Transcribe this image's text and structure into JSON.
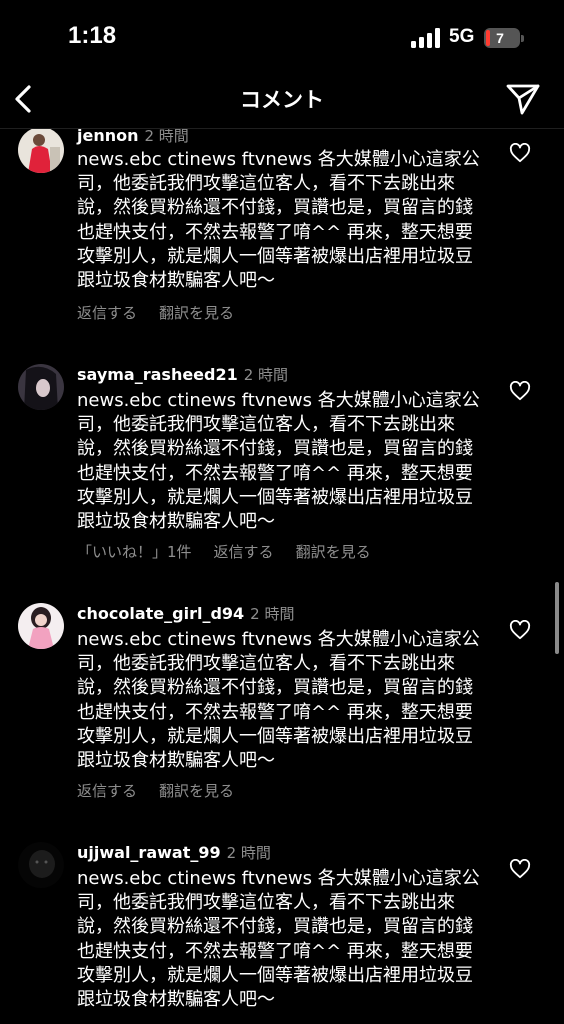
{
  "status_bar": {
    "time": "1:18",
    "network": "5G",
    "battery_level": "7",
    "battery_fill_fraction": 0.07
  },
  "header": {
    "title": "コメント",
    "back_icon": "chevron-left-icon",
    "send_icon": "paper-plane-icon"
  },
  "comments": [
    {
      "username": "jennon",
      "time_ago": "2 時間",
      "text": "news.ebc ctinews ftvnews 各大媒體小心這家公司，他委託我們攻擊這位客人，看不下去跳出來說，然後買粉絲還不付錢，買讚也是，買留言的錢也趕快支付，不然去報警了唷^^ 再來，整天想要攻擊別人，就是爛人一個等著被爆出店裡用垃圾豆跟垃圾食材欺騙客人吧～",
      "actions": [
        "返信する",
        "翻訳を見る"
      ]
    },
    {
      "username": "sayma_rasheed21",
      "time_ago": "2 時間",
      "text": "news.ebc ctinews ftvnews 各大媒體小心這家公司，他委託我們攻擊這位客人，看不下去跳出來說，然後買粉絲還不付錢，買讚也是，買留言的錢也趕快支付，不然去報警了唷^^ 再來，整天想要攻擊別人，就是爛人一個等著被爆出店裡用垃圾豆跟垃圾食材欺騙客人吧～",
      "actions": [
        "「いいね！」1件",
        "返信する",
        "翻訳を見る"
      ]
    },
    {
      "username": "chocolate_girl_d94",
      "time_ago": "2 時間",
      "text": "news.ebc ctinews ftvnews 各大媒體小心這家公司，他委託我們攻擊這位客人，看不下去跳出來說，然後買粉絲還不付錢，買讚也是，買留言的錢也趕快支付，不然去報警了唷^^ 再來，整天想要攻擊別人，就是爛人一個等著被爆出店裡用垃圾豆跟垃圾食材欺騙客人吧～",
      "actions": [
        "返信する",
        "翻訳を見る"
      ]
    },
    {
      "username": "ujjwal_rawat_99",
      "time_ago": "2 時間",
      "text": "news.ebc ctinews ftvnews 各大媒體小心這家公司，他委託我們攻擊這位客人，看不下去跳出來說，然後買粉絲還不付錢，買讚也是，買留言的錢也趕快支付，不然去報警了唷^^ 再來，整天想要攻擊別人，就是爛人一個等著被爆出店裡用垃圾豆跟垃圾食材欺騙客人吧～",
      "actions": []
    }
  ],
  "colors": {
    "background": "#000000",
    "text": "#ffffff",
    "secondary_text": "#8e8e8e",
    "battery_low": "#ff3b30"
  }
}
